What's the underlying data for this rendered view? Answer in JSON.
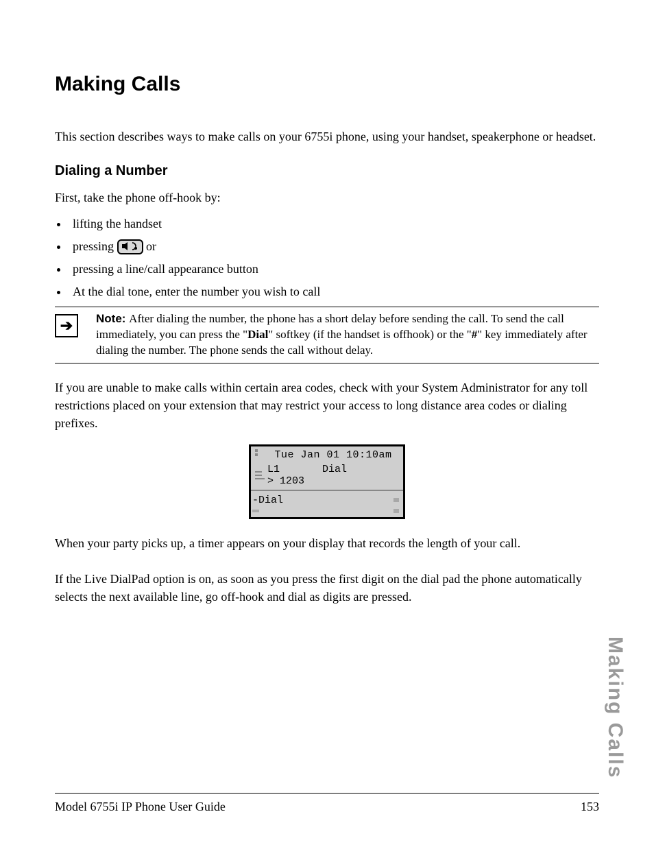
{
  "heading": "Making Calls",
  "intro": "This section describes ways to make calls on your 6755i phone, using your handset, speakerphone or headset.",
  "subheading": "Dialing a Number",
  "offhook_intro": "First, take the phone off-hook by:",
  "bullets": {
    "b1": "lifting the handset",
    "b2_pre": "pressing ",
    "b2_post": " or",
    "b3": "pressing a line/call appearance button",
    "b4": "At the dial tone, enter the number you wish to call"
  },
  "note": {
    "label": "Note: ",
    "text_pre": "After dialing the number, the phone has a short delay before sending the call. To send the call immediately, you can press the \"",
    "dial": "Dial",
    "text_mid": "\" softkey (if the handset is offhook) or the \"",
    "hash": "#",
    "text_post": "\" key immediately after dialing the number. The phone sends the call without delay."
  },
  "para_restrict": "If you are unable to make calls within certain area codes, check with your System Administrator for any toll restrictions placed on your extension that may restrict your access to long distance area codes or dialing prefixes.",
  "display": {
    "datetime": "Tue Jan 01 10:10am",
    "line": "L1",
    "state": "Dial",
    "number": "> 1203",
    "softkey": "-Dial"
  },
  "para_timer": "When your party picks up, a timer appears on your display that records the length of your call.",
  "para_livedial": "If the Live DialPad option is on, as soon as you press the first digit on the dial pad the phone automatically selects the next available line, go off-hook and dial as digits are pressed.",
  "footer": {
    "left": "Model 6755i IP Phone User Guide",
    "right": "153"
  },
  "side_tab": "Making Calls"
}
